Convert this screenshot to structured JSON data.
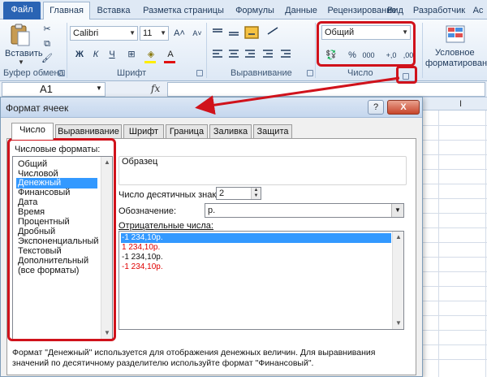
{
  "ribbon": {
    "tabs": [
      "Файл",
      "Главная",
      "Вставка",
      "Разметка страницы",
      "Формулы",
      "Данные",
      "Рецензирование",
      "Вид",
      "Разработчик",
      "Ac"
    ],
    "paste_label": "Вставить",
    "font_name": "Calibri",
    "font_size": "11",
    "bold": "Ж",
    "italic": "К",
    "underline": "Ч",
    "grow_font": "A˄",
    "shrink_font": "A˅",
    "number_format": "Общий",
    "percent": "%",
    "thousands": "000",
    "inc_decimal": "+,0",
    "dec_decimal": ",00",
    "cond_format": "Условное",
    "cond_format_2": "форматирование",
    "groups": {
      "clipboard": "Буфер обмена",
      "font": "Шрифт",
      "alignment": "Выравнивание",
      "number": "Число"
    }
  },
  "formula_bar": {
    "name_box": "A1",
    "fx": "fx"
  },
  "sheet": {
    "col_i": "I"
  },
  "dialog": {
    "title": "Формат ячеек",
    "help": "?",
    "close": "X",
    "tabs": [
      "Число",
      "Выравнивание",
      "Шрифт",
      "Граница",
      "Заливка",
      "Защита"
    ],
    "formats_label": "Числовые форматы:",
    "formats": [
      "Общий",
      "Числовой",
      "Денежный",
      "Финансовый",
      "Дата",
      "Время",
      "Процентный",
      "Дробный",
      "Экспоненциальный",
      "Текстовый",
      "Дополнительный",
      "(все форматы)"
    ],
    "selected_format": "Денежный",
    "sample_label": "Образец",
    "decimals_label": "Число десятичных знаков:",
    "decimals_value": "2",
    "symbol_label": "Обозначение:",
    "symbol_value": "р.",
    "negative_label": "Отрицательные числа:",
    "negatives": [
      {
        "text": "-1 234,10р.",
        "color": "#111111",
        "selected": true
      },
      {
        "text": "1 234,10р.",
        "color": "#e00000"
      },
      {
        "text": "-1 234,10р.",
        "color": "#111111"
      },
      {
        "text": "-1 234,10р.",
        "color": "#e00000"
      }
    ],
    "description": "Формат \"Денежный\" используется для отображения денежных величин. Для выравнивания значений по десятичному разделителю используйте формат \"Финансовый\"."
  },
  "colors": {
    "accent": "#2a64b4",
    "highlight": "#d0121b",
    "selection": "#3399ff",
    "negative_red": "#e00000"
  }
}
